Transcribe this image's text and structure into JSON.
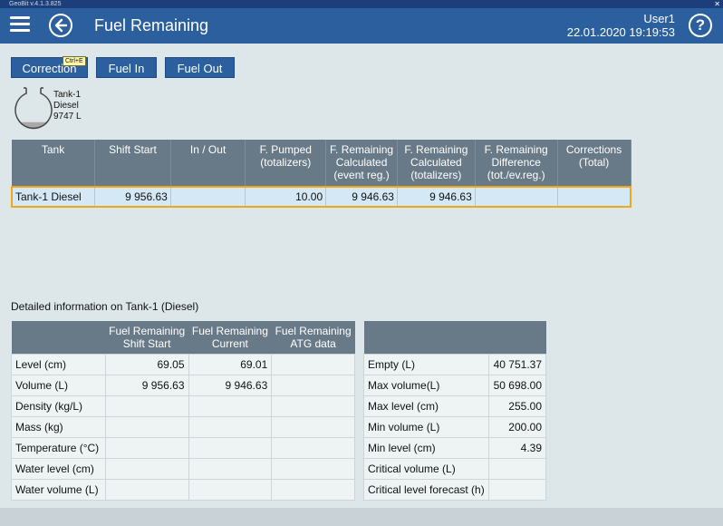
{
  "window": {
    "title": "GeoBit v.4.1.3.825",
    "close_glyph": "✕"
  },
  "header": {
    "title": "Fuel Remaining",
    "user": "User1",
    "datetime": "22.01.2020 19:19:53",
    "help_glyph": "?"
  },
  "toolbar": {
    "correction": "Correction",
    "correction_shortcut": "Ctrl+E",
    "fuel_in": "Fuel In",
    "fuel_out": "Fuel Out"
  },
  "tank": {
    "name": "Tank-1",
    "fuel": "Diesel",
    "volume": "9747 L",
    "fill_fraction": 0.2
  },
  "main_table": {
    "headers": [
      "Tank",
      "Shift Start",
      "In / Out",
      "F. Pumped\n(totalizers)",
      "F. Remaining\nCalculated\n(event reg.)",
      "F. Remaining\nCalculated\n(totalizers)",
      "F. Remaining\nDifference\n(tot./ev.reg.)",
      "Corrections\n(Total)"
    ],
    "rows": [
      [
        "Tank-1 Diesel",
        "9 956.63",
        "",
        "10.00",
        "9 946.63",
        "9 946.63",
        "",
        ""
      ]
    ]
  },
  "detail": {
    "title": "Detailed information on Tank-1 (Diesel)",
    "headers": [
      "",
      "Fuel Remaining\nShift Start",
      "Fuel Remaining\nCurrent",
      "Fuel Remaining\nATG data"
    ],
    "rows": [
      [
        "Level (cm)",
        "69.05",
        "69.01",
        ""
      ],
      [
        "Volume (L)",
        "9 956.63",
        "9 946.63",
        ""
      ],
      [
        "Density (kg/L)",
        "",
        "",
        ""
      ],
      [
        "Mass (kg)",
        "",
        "",
        ""
      ],
      [
        "Temperature (°C)",
        "",
        "",
        ""
      ],
      [
        "Water level (cm)",
        "",
        "",
        ""
      ],
      [
        "Water volume (L)",
        "",
        "",
        ""
      ]
    ]
  },
  "tank_info": {
    "rows": [
      [
        "Empty (L)",
        "40 751.37"
      ],
      [
        "Max volume(L)",
        "50 698.00"
      ],
      [
        "Max level (cm)",
        "255.00"
      ],
      [
        "Min volume (L)",
        "200.00"
      ],
      [
        "Min level (cm)",
        "4.39"
      ],
      [
        "Critical volume (L)",
        ""
      ],
      [
        "Critical level forecast (h)",
        ""
      ]
    ]
  }
}
